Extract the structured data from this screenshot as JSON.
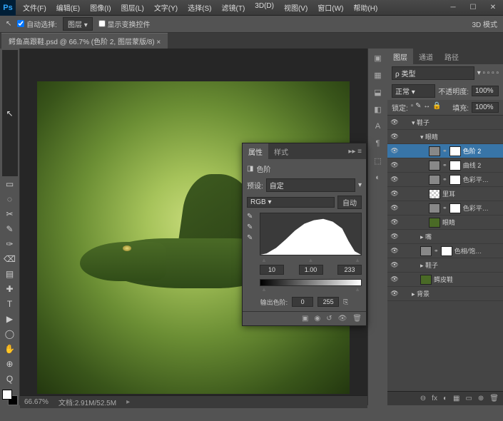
{
  "titlebar": {
    "logo": "Ps",
    "menus": [
      "文件(F)",
      "编辑(E)",
      "图像(I)",
      "图层(L)",
      "文字(Y)",
      "选择(S)",
      "滤镜(T)",
      "3D(D)",
      "视图(V)",
      "窗口(W)",
      "帮助(H)"
    ]
  },
  "options": {
    "move_icon": "↖",
    "autoselect_label": "自动选择:",
    "autoselect_value": "图层",
    "showcontrols_label": "显示变换控件",
    "trailing": "3D 模式"
  },
  "document": {
    "tab_label": "鳄鱼高跟鞋.psd @ 66.7% (色阶 2, 图层蒙版/8) ×"
  },
  "tools": [
    "↖",
    "▭",
    "◌",
    "✂",
    "✎",
    "✑",
    "⌫",
    "▤",
    "✚",
    "T",
    "▶",
    "◯",
    "✋",
    "⊕",
    "Q"
  ],
  "rightstrip": [
    "▣",
    "▦",
    "⬓",
    "◧",
    "A",
    "¶",
    "⬚",
    "◐"
  ],
  "layers_panel": {
    "tabs": [
      "图层",
      "通道",
      "路径"
    ],
    "filter_label": "ρ 类型",
    "blend_mode": "正常",
    "opacity_label": "不透明度:",
    "opacity_value": "100%",
    "lock_label": "锁定:",
    "fill_label": "填充:",
    "fill_value": "100%",
    "layers": [
      {
        "indent": 1,
        "type": "folder",
        "name": "鞋子",
        "open": true
      },
      {
        "indent": 2,
        "type": "folder",
        "name": "眼睛",
        "open": true
      },
      {
        "indent": 3,
        "type": "adj",
        "name": "色阶 2",
        "selected": true,
        "link": true
      },
      {
        "indent": 3,
        "type": "adj",
        "name": "曲线 2",
        "link": true
      },
      {
        "indent": 3,
        "type": "adj",
        "name": "色彩平…",
        "link": true
      },
      {
        "indent": 3,
        "type": "layer",
        "name": "里耳",
        "check": true
      },
      {
        "indent": 3,
        "type": "adj",
        "name": "色彩平…",
        "link": true
      },
      {
        "indent": 3,
        "type": "layer",
        "name": "眼睛",
        "green": true
      },
      {
        "indent": 2,
        "type": "folder",
        "name": "嘴"
      },
      {
        "indent": 2,
        "type": "adj",
        "name": "色相/饱…"
      },
      {
        "indent": 2,
        "type": "folder",
        "name": "鞋子"
      },
      {
        "indent": 2,
        "type": "layer",
        "name": "鳄皮鞋",
        "green": true
      },
      {
        "indent": 1,
        "type": "folder",
        "name": "背景"
      }
    ],
    "footer_icons": [
      "⊖",
      "fx",
      "◐",
      "▦",
      "▭",
      "⊕",
      "🗑"
    ]
  },
  "properties": {
    "tabs": [
      "属性",
      "样式"
    ],
    "type_label": "色阶",
    "preset_label": "预设:",
    "preset_value": "自定",
    "channel_value": "RGB",
    "auto_label": "自动",
    "input_black": "10",
    "input_gamma": "1.00",
    "input_white": "233",
    "output_label": "输出色阶:",
    "output_black": "0",
    "output_white": "255",
    "clip_icon": "⎘",
    "bottom_icons": [
      "▣",
      "◉",
      "↺",
      "👁",
      "🗑"
    ]
  },
  "status": {
    "zoom": "66.67%",
    "docinfo": "文档:2.91M/52.5M"
  }
}
